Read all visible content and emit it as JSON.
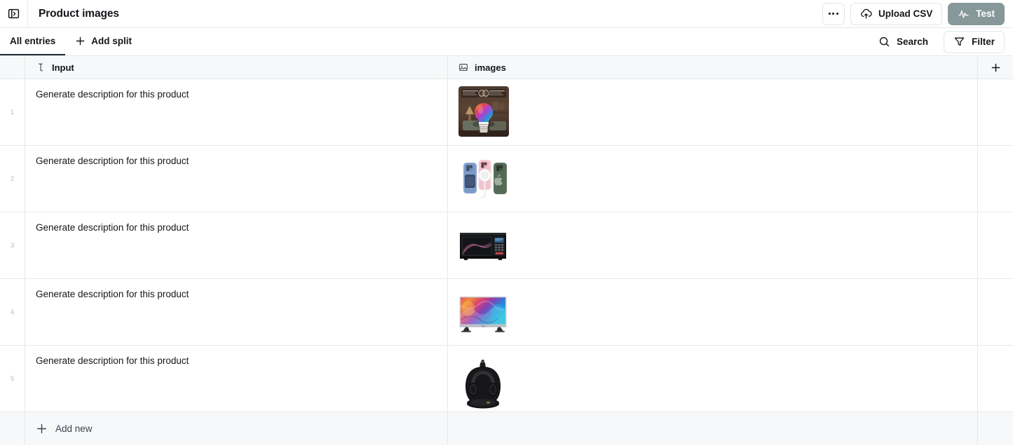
{
  "header": {
    "panel_toggle_icon": "sidebar-panel-icon",
    "title": "Product images",
    "more_icon": "ellipsis-icon",
    "upload_csv_label": "Upload CSV",
    "upload_csv_icon": "cloud-upload-icon",
    "test_label": "Test",
    "test_icon": "activity-pulse-icon",
    "test_button_color": "#87989a"
  },
  "tabs": {
    "all_entries_label": "All entries",
    "add_split_label": "Add split",
    "add_split_icon": "plus-icon",
    "search_label": "Search",
    "search_icon": "magnifier-icon",
    "filter_label": "Filter",
    "filter_icon": "funnel-icon",
    "active_underline_color": "#1c2b33"
  },
  "table": {
    "columns": [
      {
        "label": "Input",
        "icon": "text-cursor-icon"
      },
      {
        "label": "images",
        "icon": "image-icon"
      }
    ],
    "add_column_icon": "plus-icon",
    "rows": [
      {
        "number": "1",
        "input": "Generate description for this product",
        "image": "smart-rgb-light-bulb"
      },
      {
        "number": "2",
        "input": "Generate description for this product",
        "image": "three-smartphones-blue-pink-green"
      },
      {
        "number": "3",
        "input": "Generate description for this product",
        "image": "black-microwave-oven"
      },
      {
        "number": "4",
        "input": "Generate description for this product",
        "image": "flat-screen-tv-colorful-display"
      },
      {
        "number": "5",
        "input": "Generate description for this product",
        "image": "black-over-ear-headphones-case"
      }
    ],
    "add_new_label": "Add new",
    "add_new_icon": "plus-icon"
  }
}
